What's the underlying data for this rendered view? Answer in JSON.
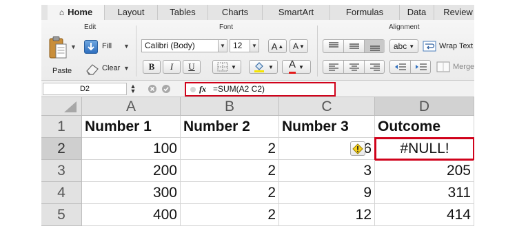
{
  "ribbon": {
    "tabs": [
      {
        "label": "Home",
        "active": true
      },
      {
        "label": "Layout"
      },
      {
        "label": "Tables"
      },
      {
        "label": "Charts"
      },
      {
        "label": "SmartArt"
      },
      {
        "label": "Formulas"
      },
      {
        "label": "Data"
      },
      {
        "label": "Review"
      }
    ],
    "groups": {
      "edit": "Edit",
      "font": "Font",
      "alignment": "Alignment"
    },
    "edit": {
      "paste_label": "Paste",
      "fill_label": "Fill",
      "clear_label": "Clear"
    },
    "font": {
      "font_name": "Calibri (Body)",
      "font_size": "12",
      "bold": "B",
      "italic": "I",
      "underline": "U",
      "grow": "A",
      "shrink": "A",
      "font_color_glyph": "A",
      "font_color": "#e31b1b",
      "highlight_color": "#f5e400"
    },
    "alignment": {
      "text_box_label": "abc",
      "wrap_label": "Wrap Text",
      "merge_label": "Merge"
    }
  },
  "formula_bar": {
    "name_box": "D2",
    "fx_label": "fx",
    "formula": "=SUM(A2 C2)"
  },
  "sheet": {
    "columns": [
      "A",
      "B",
      "C",
      "D"
    ],
    "row_numbers": [
      "1",
      "2",
      "3",
      "4",
      "5"
    ],
    "headers": [
      "Number 1",
      "Number 2",
      "Number 3",
      "Outcome"
    ],
    "rows": [
      [
        "100",
        "2",
        "6",
        "#NULL!"
      ],
      [
        "200",
        "2",
        "3",
        "205"
      ],
      [
        "300",
        "2",
        "9",
        "311"
      ],
      [
        "400",
        "2",
        "12",
        "414"
      ]
    ]
  },
  "colors": {
    "highlight_border": "#d0021b",
    "ribbon_bg": "#ededed"
  }
}
